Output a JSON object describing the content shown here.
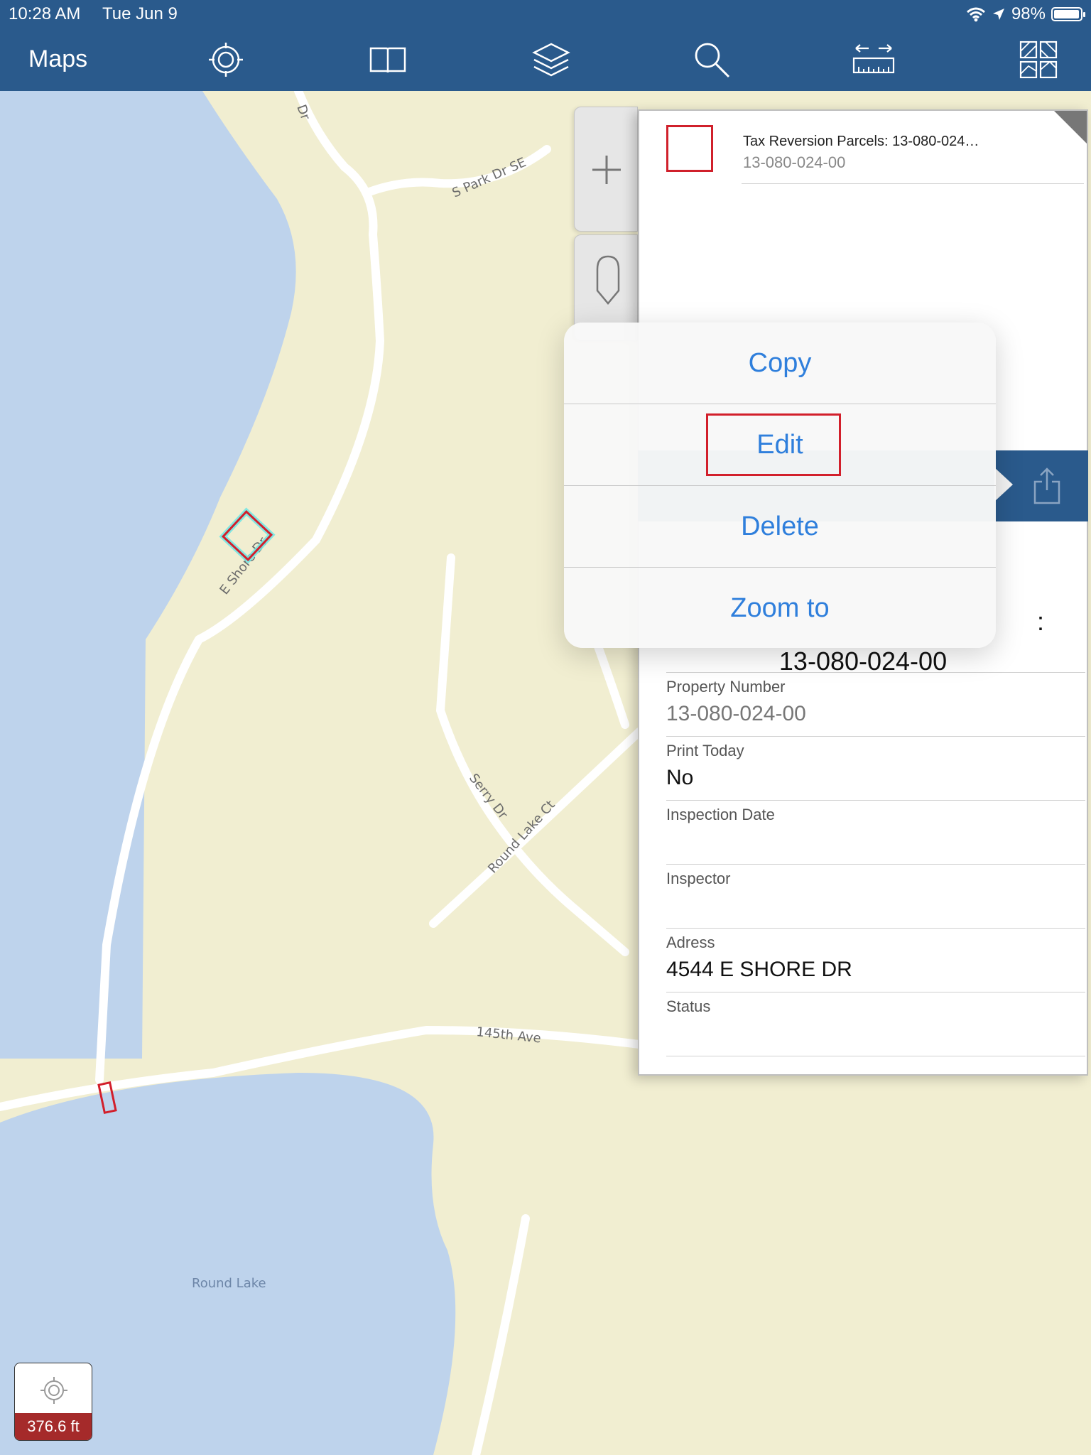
{
  "status_bar": {
    "time": "10:28 AM",
    "date": "Tue Jun 9",
    "battery": "98%"
  },
  "toolbar": {
    "maps_label": "Maps",
    "icons": [
      "locate-icon",
      "bookmarks-icon",
      "layers-icon",
      "search-icon",
      "measure-icon",
      "basemap-icon"
    ]
  },
  "map": {
    "labels": {
      "s_park": "S Park Dr SE",
      "e_shore": "E Shore Dr",
      "serry": "Serry Dr",
      "round_lake_ct": "Round Lake Ct",
      "ave_145": "145th Ave",
      "round_lake": "Round Lake",
      "dr_fragment": "Dr"
    },
    "scale_label": "376.6 ft"
  },
  "results_panel": {
    "item_title": "Tax Reversion Parcels: 13-080-024…",
    "item_subtitle": "13-080-024-00"
  },
  "details": {
    "header_visible": "13-080-024-00",
    "header_colon": ":",
    "fields": [
      {
        "label": "Property Number",
        "value": "13-080-024-00"
      },
      {
        "label": "Print Today",
        "value": "No"
      },
      {
        "label": "Inspection Date",
        "value": ""
      },
      {
        "label": "Inspector",
        "value": ""
      },
      {
        "label": "Adress",
        "value": "4544 E SHORE DR"
      },
      {
        "label": "Status",
        "value": ""
      }
    ]
  },
  "context_menu": {
    "items": [
      "Copy",
      "Edit",
      "Delete",
      "Zoom to"
    ]
  },
  "colors": {
    "toolbar": "#2a5a8c",
    "land": "#f1eed1",
    "water": "#bed3ec",
    "accent": "#2f7fdc",
    "highlight": "#d21f2b"
  }
}
